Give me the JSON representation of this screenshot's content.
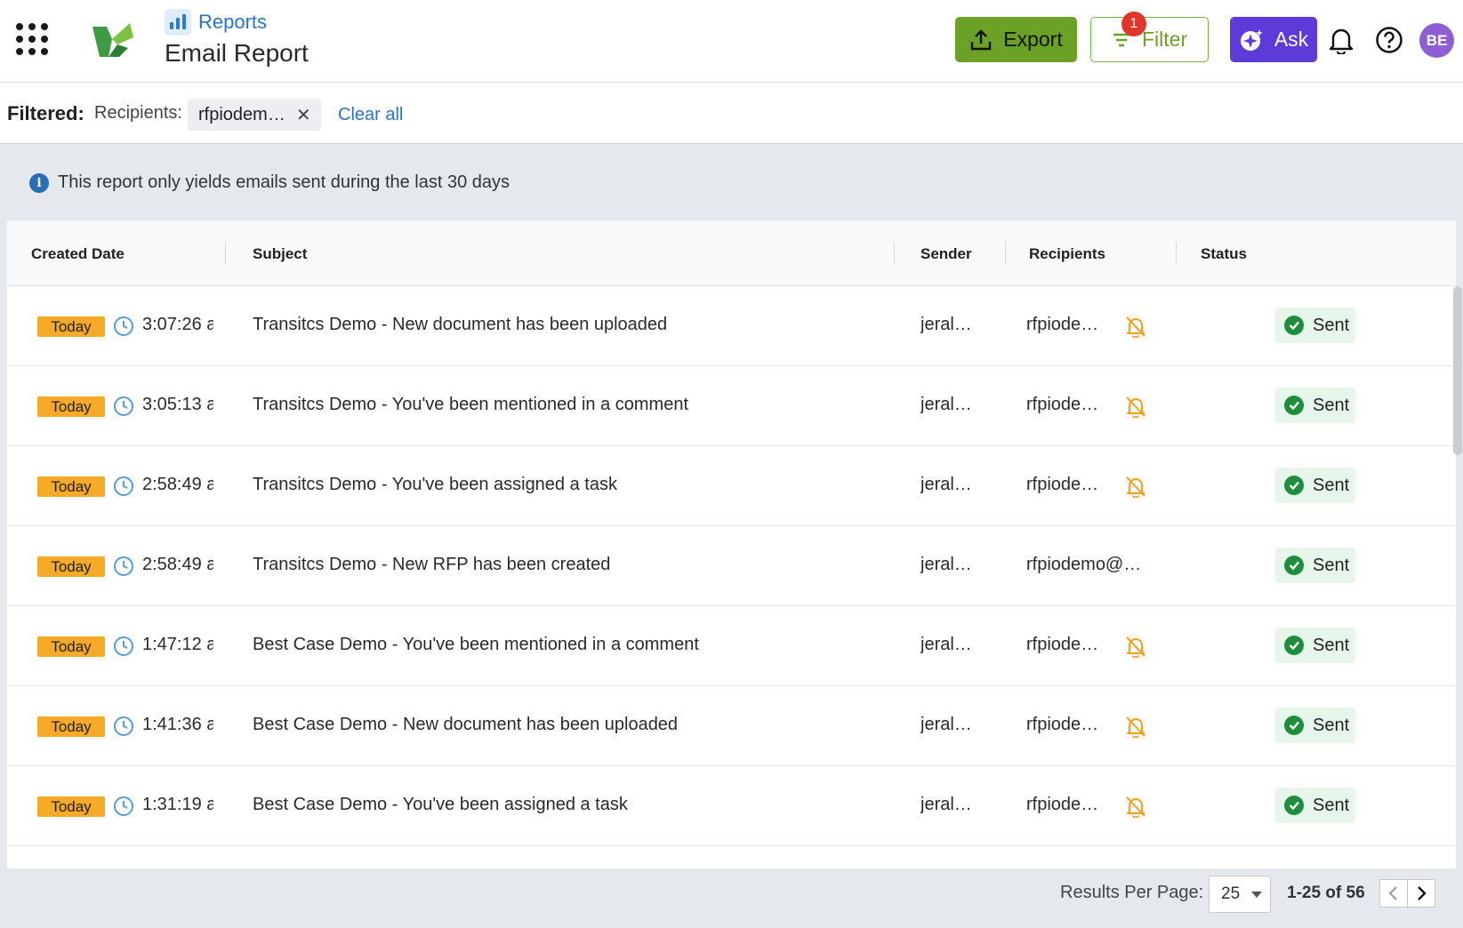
{
  "header": {
    "breadcrumb": "Reports",
    "title": "Email Report",
    "export_label": "Export",
    "filter_label": "Filter",
    "filter_badge": "1",
    "ask_label": "Ask",
    "avatar_initials": "BE",
    "colors": {
      "export": "#6aa126",
      "ask": "#5d3bd8",
      "badge": "#e0352b"
    }
  },
  "filterbar": {
    "filtered_label": "Filtered:",
    "recipients_label": "Recipients:",
    "chip_value": "rfpiodem…",
    "clear_all": "Clear all"
  },
  "info": {
    "text": "This report only yields emails sent during the last 30 days"
  },
  "table": {
    "columns": [
      "Created Date",
      "Subject",
      "Sender",
      "Recipients",
      "Status"
    ],
    "rows": [
      {
        "date": "Today",
        "time": "3:07:26 a",
        "subject": "Transitcs Demo - New document has been uploaded",
        "sender": "jeral…",
        "recipients": "rfpiode…",
        "bell_off": true,
        "status": "Sent"
      },
      {
        "date": "Today",
        "time": "3:05:13 a",
        "subject": "Transitcs Demo - You've been mentioned in a comment",
        "sender": "jeral…",
        "recipients": "rfpiode…",
        "bell_off": true,
        "status": "Sent"
      },
      {
        "date": "Today",
        "time": "2:58:49 a",
        "subject": "Transitcs Demo - You've been assigned a task",
        "sender": "jeral…",
        "recipients": "rfpiode…",
        "bell_off": true,
        "status": "Sent"
      },
      {
        "date": "Today",
        "time": "2:58:49 a",
        "subject": "Transitcs Demo - New RFP has been created",
        "sender": "jeral…",
        "recipients": "rfpiodemo@…",
        "bell_off": false,
        "status": "Sent"
      },
      {
        "date": "Today",
        "time": "1:47:12 a",
        "subject": "Best Case Demo - You've been mentioned in a comment",
        "sender": "jeral…",
        "recipients": "rfpiode…",
        "bell_off": true,
        "status": "Sent"
      },
      {
        "date": "Today",
        "time": "1:41:36 a",
        "subject": "Best Case Demo - New document has been uploaded",
        "sender": "jeral…",
        "recipients": "rfpiode…",
        "bell_off": true,
        "status": "Sent"
      },
      {
        "date": "Today",
        "time": "1:31:19 a",
        "subject": "Best Case Demo - You've been assigned a task",
        "sender": "jeral…",
        "recipients": "rfpiode…",
        "bell_off": true,
        "status": "Sent"
      }
    ]
  },
  "footer": {
    "per_page_label": "Results Per Page:",
    "per_page_value": "25",
    "range": "1-25 of 56"
  }
}
